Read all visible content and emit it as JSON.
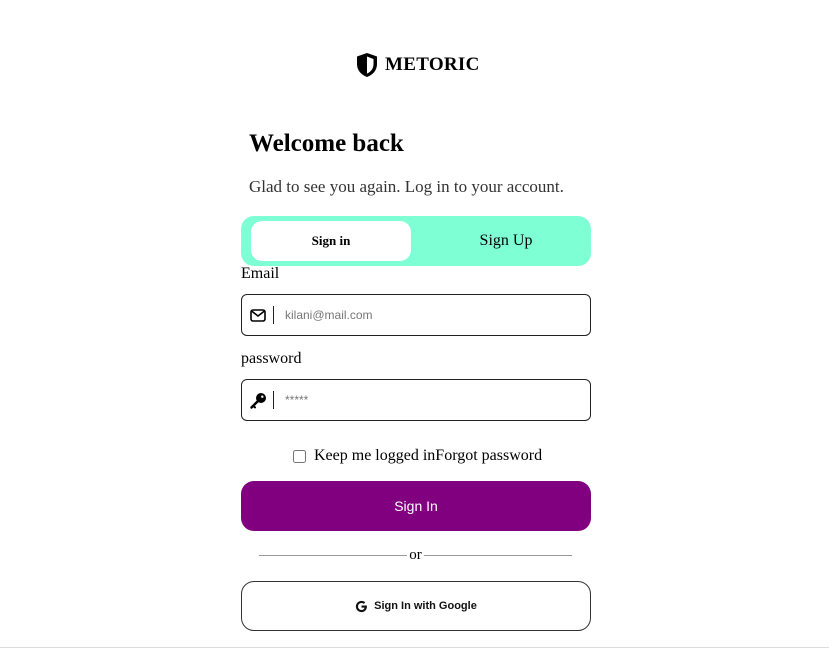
{
  "brand": {
    "name": "METORIC",
    "icon": "shield-icon"
  },
  "heading": {
    "title": "Welcome back",
    "subtitle": "Glad to see you again. Log in to your account."
  },
  "tabs": {
    "signin_label": "Sign in",
    "signup_label": "Sign Up",
    "active": "signin"
  },
  "form": {
    "email_label": "Email",
    "email_placeholder": "kilani@mail.com",
    "email_icon": "envelope-icon",
    "password_label": "password",
    "password_placeholder": "*****",
    "password_icon": "key-icon",
    "keep_logged_in": "Keep me logged in",
    "forgot_password": "Forgot password",
    "submit_label": "Sign In",
    "divider_text": "or",
    "google_label": "Sign In with Google",
    "google_icon": "google-icon"
  },
  "colors": {
    "tab_background": "#7fffd4",
    "primary_button": "#800080",
    "background": "#ffffff"
  }
}
